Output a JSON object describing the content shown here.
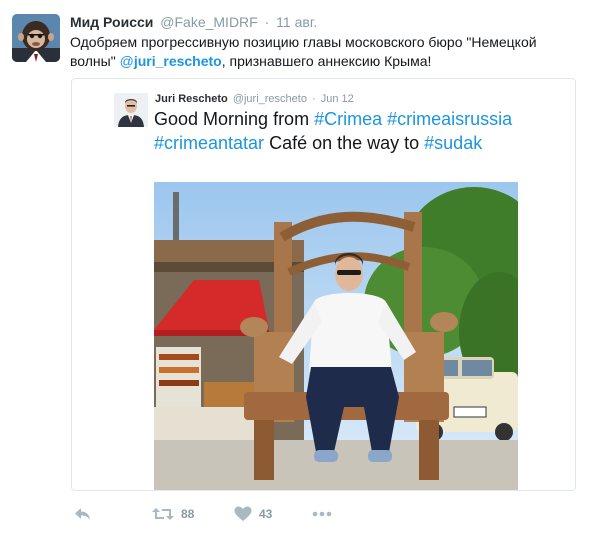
{
  "tweet": {
    "fullname": "Мид Роисси",
    "screen_name": "@Fake_MIDRF",
    "separator": "·",
    "time": "11 авг.",
    "text_before": "Одобряем прогрессивную позицию главы московского бюро \"Немецкой волны\" ",
    "mention_at": "@",
    "mention_name": "juri_rescheto",
    "text_after": ", признавшего аннексию Крыма!"
  },
  "quote": {
    "name": "Juri Rescheto",
    "screen_name": "@juri_rescheto",
    "separator": "·",
    "time": "Jun 12",
    "text_1": "Good Morning from ",
    "hashtag_1": "#Crimea",
    "hashtag_2": "#crimeaisrussia",
    "hashtag_3": "#crimeantatar",
    "text_2": " Café on the way to ",
    "hashtag_4": "#sudak"
  },
  "actions": {
    "retweet_count": "88",
    "like_count": "43"
  },
  "icons": [
    "reply-icon",
    "retweet-icon",
    "heart-icon",
    "more-icon"
  ],
  "colors": {
    "link": "#1b95e0",
    "muted": "#8899a6",
    "icon": "#aab8c2"
  }
}
